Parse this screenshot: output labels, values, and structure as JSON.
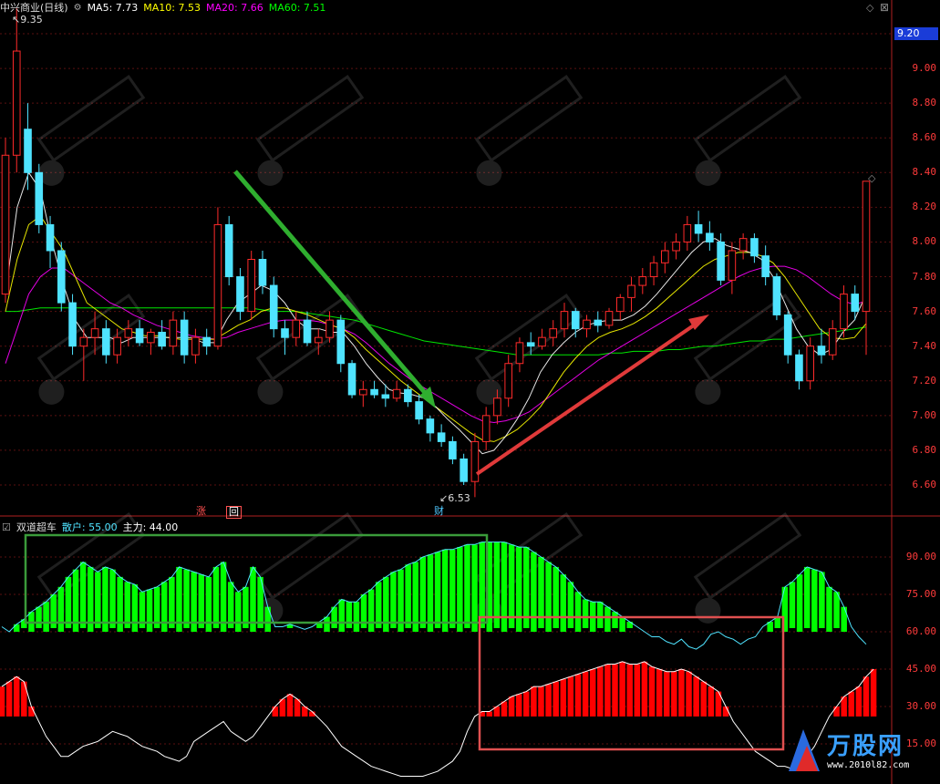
{
  "main_header": {
    "stock_name": "中兴商业(日线)",
    "ma5": "MA5: 7.73",
    "ma10": "MA10: 7.53",
    "ma20": "MA20: 7.66",
    "ma60": "MA60: 7.51"
  },
  "sub_header": {
    "indicator": "双道超车",
    "retail": "散户: 55.00",
    "main_force": "主力: 44.00"
  },
  "current_price": "9.20",
  "high_label": "9.35",
  "low_label": "6.53",
  "tags": [
    "涨",
    "回",
    "财"
  ],
  "brand": {
    "name": "万股网",
    "url": "www.2010l82.com"
  },
  "colors": {
    "up": "#ff2a2a",
    "down": "#4fe3ff",
    "ma5": "#ffffff",
    "ma10": "#ffff00",
    "ma20": "#ff00ff",
    "ma60": "#00ff00",
    "retail_bar": "#00ff00",
    "main_bar": "#ff0000",
    "retail_line": "#4fe3ff",
    "main_line": "#ffffff"
  },
  "chart_data": [
    {
      "type": "candlestick",
      "title": "中兴商业(日线)",
      "ylim": [
        6.45,
        9.45
      ],
      "y_ticks": [
        9.2,
        9.0,
        8.8,
        8.6,
        8.4,
        8.2,
        8.0,
        7.8,
        7.6,
        7.4,
        7.2,
        7.0,
        6.8,
        6.6
      ],
      "candles": [
        {
          "o": 7.7,
          "h": 8.6,
          "l": 7.65,
          "c": 8.5
        },
        {
          "o": 8.5,
          "h": 9.35,
          "l": 8.4,
          "c": 9.1
        },
        {
          "o": 8.65,
          "h": 8.8,
          "l": 8.3,
          "c": 8.4
        },
        {
          "o": 8.4,
          "h": 8.45,
          "l": 8.05,
          "c": 8.1
        },
        {
          "o": 8.1,
          "h": 8.15,
          "l": 7.85,
          "c": 7.95
        },
        {
          "o": 7.95,
          "h": 8.0,
          "l": 7.6,
          "c": 7.65
        },
        {
          "o": 7.65,
          "h": 7.7,
          "l": 7.35,
          "c": 7.4
        },
        {
          "o": 7.4,
          "h": 7.5,
          "l": 7.2,
          "c": 7.45
        },
        {
          "o": 7.45,
          "h": 7.6,
          "l": 7.35,
          "c": 7.5
        },
        {
          "o": 7.5,
          "h": 7.55,
          "l": 7.3,
          "c": 7.35
        },
        {
          "o": 7.35,
          "h": 7.5,
          "l": 7.3,
          "c": 7.45
        },
        {
          "o": 7.45,
          "h": 7.55,
          "l": 7.4,
          "c": 7.5
        },
        {
          "o": 7.5,
          "h": 7.55,
          "l": 7.4,
          "c": 7.42
        },
        {
          "o": 7.42,
          "h": 7.5,
          "l": 7.35,
          "c": 7.48
        },
        {
          "o": 7.48,
          "h": 7.55,
          "l": 7.38,
          "c": 7.4
        },
        {
          "o": 7.4,
          "h": 7.6,
          "l": 7.35,
          "c": 7.55
        },
        {
          "o": 7.55,
          "h": 7.6,
          "l": 7.3,
          "c": 7.35
        },
        {
          "o": 7.35,
          "h": 7.5,
          "l": 7.3,
          "c": 7.45
        },
        {
          "o": 7.45,
          "h": 7.5,
          "l": 7.35,
          "c": 7.4
        },
        {
          "o": 7.4,
          "h": 8.2,
          "l": 7.38,
          "c": 8.1
        },
        {
          "o": 8.1,
          "h": 8.15,
          "l": 7.75,
          "c": 7.8
        },
        {
          "o": 7.8,
          "h": 7.85,
          "l": 7.55,
          "c": 7.6
        },
        {
          "o": 7.6,
          "h": 7.95,
          "l": 7.55,
          "c": 7.9
        },
        {
          "o": 7.9,
          "h": 7.95,
          "l": 7.7,
          "c": 7.75
        },
        {
          "o": 7.75,
          "h": 7.8,
          "l": 7.45,
          "c": 7.5
        },
        {
          "o": 7.5,
          "h": 7.55,
          "l": 7.35,
          "c": 7.45
        },
        {
          "o": 7.45,
          "h": 7.6,
          "l": 7.4,
          "c": 7.55
        },
        {
          "o": 7.55,
          "h": 7.6,
          "l": 7.4,
          "c": 7.42
        },
        {
          "o": 7.42,
          "h": 7.5,
          "l": 7.35,
          "c": 7.45
        },
        {
          "o": 7.45,
          "h": 7.6,
          "l": 7.42,
          "c": 7.55
        },
        {
          "o": 7.55,
          "h": 7.58,
          "l": 7.25,
          "c": 7.3
        },
        {
          "o": 7.3,
          "h": 7.32,
          "l": 7.1,
          "c": 7.12
        },
        {
          "o": 7.12,
          "h": 7.2,
          "l": 7.05,
          "c": 7.15
        },
        {
          "o": 7.15,
          "h": 7.2,
          "l": 7.1,
          "c": 7.12
        },
        {
          "o": 7.12,
          "h": 7.18,
          "l": 7.05,
          "c": 7.1
        },
        {
          "o": 7.1,
          "h": 7.2,
          "l": 7.08,
          "c": 7.15
        },
        {
          "o": 7.15,
          "h": 7.18,
          "l": 7.05,
          "c": 7.08
        },
        {
          "o": 7.08,
          "h": 7.12,
          "l": 6.95,
          "c": 6.98
        },
        {
          "o": 6.98,
          "h": 7.0,
          "l": 6.85,
          "c": 6.9
        },
        {
          "o": 6.9,
          "h": 6.95,
          "l": 6.82,
          "c": 6.85
        },
        {
          "o": 6.85,
          "h": 6.88,
          "l": 6.72,
          "c": 6.75
        },
        {
          "o": 6.75,
          "h": 6.78,
          "l": 6.6,
          "c": 6.62
        },
        {
          "o": 6.62,
          "h": 6.9,
          "l": 6.53,
          "c": 6.85
        },
        {
          "o": 6.85,
          "h": 7.05,
          "l": 6.8,
          "c": 7.0
        },
        {
          "o": 7.0,
          "h": 7.15,
          "l": 6.95,
          "c": 7.1
        },
        {
          "o": 7.1,
          "h": 7.35,
          "l": 7.05,
          "c": 7.3
        },
        {
          "o": 7.3,
          "h": 7.45,
          "l": 7.25,
          "c": 7.42
        },
        {
          "o": 7.42,
          "h": 7.48,
          "l": 7.35,
          "c": 7.4
        },
        {
          "o": 7.4,
          "h": 7.5,
          "l": 7.38,
          "c": 7.45
        },
        {
          "o": 7.45,
          "h": 7.55,
          "l": 7.4,
          "c": 7.5
        },
        {
          "o": 7.5,
          "h": 7.65,
          "l": 7.45,
          "c": 7.6
        },
        {
          "o": 7.6,
          "h": 7.62,
          "l": 7.45,
          "c": 7.5
        },
        {
          "o": 7.5,
          "h": 7.58,
          "l": 7.45,
          "c": 7.55
        },
        {
          "o": 7.55,
          "h": 7.6,
          "l": 7.48,
          "c": 7.52
        },
        {
          "o": 7.52,
          "h": 7.62,
          "l": 7.5,
          "c": 7.6
        },
        {
          "o": 7.6,
          "h": 7.7,
          "l": 7.55,
          "c": 7.68
        },
        {
          "o": 7.68,
          "h": 7.8,
          "l": 7.6,
          "c": 7.75
        },
        {
          "o": 7.75,
          "h": 7.85,
          "l": 7.7,
          "c": 7.8
        },
        {
          "o": 7.8,
          "h": 7.92,
          "l": 7.75,
          "c": 7.88
        },
        {
          "o": 7.88,
          "h": 8.0,
          "l": 7.82,
          "c": 7.95
        },
        {
          "o": 7.95,
          "h": 8.05,
          "l": 7.9,
          "c": 8.0
        },
        {
          "o": 8.0,
          "h": 8.15,
          "l": 7.95,
          "c": 8.1
        },
        {
          "o": 8.1,
          "h": 8.18,
          "l": 8.0,
          "c": 8.05
        },
        {
          "o": 8.05,
          "h": 8.12,
          "l": 7.95,
          "c": 8.0
        },
        {
          "o": 8.0,
          "h": 8.05,
          "l": 7.75,
          "c": 7.78
        },
        {
          "o": 7.78,
          "h": 8.0,
          "l": 7.7,
          "c": 7.95
        },
        {
          "o": 7.95,
          "h": 8.05,
          "l": 7.9,
          "c": 8.02
        },
        {
          "o": 8.02,
          "h": 8.05,
          "l": 7.88,
          "c": 7.92
        },
        {
          "o": 7.92,
          "h": 7.98,
          "l": 7.75,
          "c": 7.8
        },
        {
          "o": 7.8,
          "h": 7.82,
          "l": 7.55,
          "c": 7.58
        },
        {
          "o": 7.58,
          "h": 7.6,
          "l": 7.3,
          "c": 7.35
        },
        {
          "o": 7.35,
          "h": 7.38,
          "l": 7.15,
          "c": 7.2
        },
        {
          "o": 7.2,
          "h": 7.45,
          "l": 7.15,
          "c": 7.4
        },
        {
          "o": 7.4,
          "h": 7.5,
          "l": 7.3,
          "c": 7.35
        },
        {
          "o": 7.35,
          "h": 7.55,
          "l": 7.32,
          "c": 7.5
        },
        {
          "o": 7.5,
          "h": 7.75,
          "l": 7.45,
          "c": 7.7
        },
        {
          "o": 7.7,
          "h": 7.75,
          "l": 7.55,
          "c": 7.6
        },
        {
          "o": 7.6,
          "h": 8.35,
          "l": 7.35,
          "c": 8.35
        }
      ],
      "ma": {
        "ma5": [
          7.7,
          8.2,
          8.4,
          8.3,
          8.0,
          7.75,
          7.55,
          7.45,
          7.45,
          7.45,
          7.42,
          7.45,
          7.45,
          7.45,
          7.45,
          7.45,
          7.45,
          7.42,
          7.42,
          7.55,
          7.65,
          7.7,
          7.75,
          7.72,
          7.65,
          7.55,
          7.5,
          7.5,
          7.48,
          7.48,
          7.4,
          7.3,
          7.22,
          7.15,
          7.13,
          7.12,
          7.1,
          7.05,
          6.98,
          6.92,
          6.85,
          6.78,
          6.8,
          6.88,
          6.98,
          7.1,
          7.25,
          7.35,
          7.42,
          7.48,
          7.52,
          7.54,
          7.55,
          7.55,
          7.58,
          7.63,
          7.7,
          7.78,
          7.86,
          7.94,
          8.0,
          8.02,
          7.98,
          7.96,
          7.94,
          7.9,
          7.8,
          7.65,
          7.5,
          7.4,
          7.35,
          7.38,
          7.48,
          7.55,
          7.7
        ],
        "ma10": [
          7.6,
          7.9,
          8.1,
          8.15,
          8.05,
          7.95,
          7.8,
          7.65,
          7.6,
          7.55,
          7.5,
          7.48,
          7.46,
          7.46,
          7.45,
          7.44,
          7.44,
          7.44,
          7.44,
          7.48,
          7.52,
          7.55,
          7.6,
          7.62,
          7.62,
          7.6,
          7.58,
          7.55,
          7.52,
          7.5,
          7.45,
          7.38,
          7.32,
          7.26,
          7.2,
          7.15,
          7.1,
          7.05,
          7.0,
          6.95,
          6.9,
          6.86,
          6.85,
          6.88,
          6.92,
          6.98,
          7.05,
          7.15,
          7.25,
          7.33,
          7.4,
          7.45,
          7.48,
          7.5,
          7.53,
          7.57,
          7.62,
          7.68,
          7.74,
          7.8,
          7.86,
          7.9,
          7.92,
          7.94,
          7.94,
          7.92,
          7.88,
          7.8,
          7.7,
          7.6,
          7.5,
          7.45,
          7.44,
          7.45,
          7.53
        ],
        "ma20": [
          7.3,
          7.5,
          7.7,
          7.8,
          7.85,
          7.85,
          7.8,
          7.75,
          7.7,
          7.65,
          7.62,
          7.58,
          7.55,
          7.52,
          7.5,
          7.48,
          7.46,
          7.45,
          7.44,
          7.45,
          7.48,
          7.5,
          7.52,
          7.54,
          7.55,
          7.55,
          7.55,
          7.54,
          7.52,
          7.5,
          7.47,
          7.42,
          7.36,
          7.3,
          7.25,
          7.2,
          7.16,
          7.12,
          7.08,
          7.04,
          7.0,
          6.97,
          6.96,
          6.97,
          6.99,
          7.02,
          7.07,
          7.12,
          7.17,
          7.22,
          7.27,
          7.32,
          7.36,
          7.4,
          7.44,
          7.48,
          7.52,
          7.56,
          7.6,
          7.64,
          7.68,
          7.72,
          7.76,
          7.8,
          7.83,
          7.85,
          7.86,
          7.86,
          7.84,
          7.8,
          7.75,
          7.7,
          7.66,
          7.64,
          7.66
        ],
        "ma60": [
          7.6,
          7.6,
          7.61,
          7.62,
          7.62,
          7.62,
          7.62,
          7.62,
          7.62,
          7.62,
          7.62,
          7.62,
          7.62,
          7.62,
          7.62,
          7.62,
          7.62,
          7.62,
          7.62,
          7.62,
          7.62,
          7.62,
          7.61,
          7.6,
          7.6,
          7.6,
          7.59,
          7.58,
          7.57,
          7.56,
          7.55,
          7.53,
          7.51,
          7.49,
          7.47,
          7.45,
          7.43,
          7.42,
          7.41,
          7.4,
          7.39,
          7.38,
          7.37,
          7.36,
          7.35,
          7.35,
          7.35,
          7.35,
          7.35,
          7.35,
          7.35,
          7.35,
          7.36,
          7.36,
          7.37,
          7.37,
          7.37,
          7.38,
          7.38,
          7.39,
          7.4,
          7.4,
          7.41,
          7.42,
          7.43,
          7.43,
          7.44,
          7.44,
          7.45,
          7.46,
          7.47,
          7.48,
          7.49,
          7.5,
          7.51
        ]
      }
    },
    {
      "type": "bar",
      "title": "双道超车",
      "ylim": [
        0,
        100
      ],
      "y_ticks": [
        90.0,
        75.0,
        60.0,
        45.0,
        30.0,
        15.0
      ],
      "series": [
        {
          "name": "散户",
          "values": [
            62,
            60,
            63,
            65,
            68,
            70,
            72,
            75,
            78,
            82,
            85,
            88,
            86,
            84,
            86,
            85,
            82,
            80,
            79,
            76,
            77,
            78,
            80,
            82,
            86,
            85,
            84,
            83,
            82,
            86,
            88,
            80,
            76,
            78,
            86,
            82,
            70,
            62,
            62,
            63,
            62,
            61,
            62,
            64,
            66,
            70,
            73,
            72,
            72,
            75,
            77,
            80,
            82,
            84,
            85,
            87,
            88,
            90,
            91,
            92,
            93,
            93,
            94,
            95,
            95,
            96,
            96,
            96,
            96,
            95,
            94,
            94,
            92,
            90,
            88,
            86,
            83,
            80,
            76,
            73,
            72,
            72,
            70,
            68,
            66,
            64,
            62,
            60,
            58,
            58,
            56,
            55,
            57,
            54,
            53,
            55,
            59,
            60,
            58,
            57,
            55,
            57,
            58,
            62,
            64,
            66,
            78,
            80,
            83,
            86,
            85,
            84,
            78,
            76,
            70,
            62,
            58,
            55
          ]
        },
        {
          "name": "主力",
          "values": [
            38,
            40,
            42,
            40,
            30,
            24,
            18,
            14,
            10,
            10,
            12,
            14,
            15,
            16,
            18,
            20,
            19,
            18,
            16,
            14,
            13,
            12,
            10,
            9,
            8,
            10,
            16,
            18,
            20,
            22,
            24,
            20,
            18,
            16,
            18,
            22,
            26,
            30,
            33,
            35,
            33,
            30,
            28,
            25,
            22,
            18,
            14,
            12,
            10,
            8,
            6,
            5,
            4,
            3,
            2,
            2,
            2,
            2,
            3,
            4,
            6,
            8,
            12,
            20,
            26,
            28,
            28,
            30,
            32,
            34,
            35,
            36,
            38,
            38,
            39,
            40,
            41,
            42,
            43,
            44,
            45,
            46,
            47,
            47,
            48,
            47,
            47,
            48,
            46,
            45,
            44,
            44,
            45,
            44,
            42,
            40,
            38,
            36,
            30,
            24,
            20,
            16,
            12,
            10,
            8,
            6,
            6,
            5,
            7,
            10,
            14,
            20,
            26,
            30,
            34,
            36,
            38,
            42,
            45
          ]
        }
      ]
    }
  ]
}
